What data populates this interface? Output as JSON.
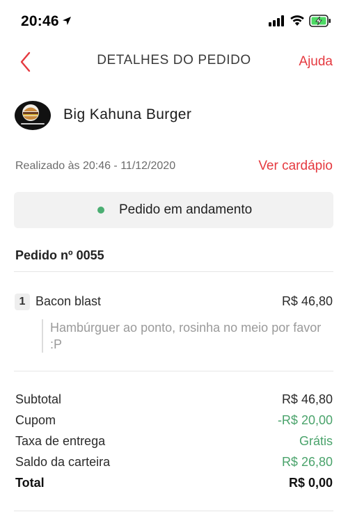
{
  "status_bar": {
    "time": "20:46"
  },
  "header": {
    "title": "DETALHES DO PEDIDO",
    "help_label": "Ajuda"
  },
  "restaurant": {
    "name": "Big Kahuna Burger"
  },
  "order": {
    "placed_at": "Realizado às 20:46 - 11/12/2020",
    "menu_link": "Ver cardápio",
    "status": "Pedido em andamento",
    "status_color": "#4bae72",
    "number": "Pedido nº 0055"
  },
  "items": [
    {
      "qty": "1",
      "name": "Bacon blast",
      "price": "R$ 46,80",
      "note": "Hambúrguer ao ponto, rosinha no meio por favor :P"
    }
  ],
  "summary": {
    "subtotal_label": "Subtotal",
    "subtotal_value": "R$ 46,80",
    "coupon_label": "Cupom",
    "coupon_value": "-R$ 20,00",
    "delivery_label": "Taxa de entrega",
    "delivery_value": "Grátis",
    "wallet_label": "Saldo da carteira",
    "wallet_value": "R$ 26,80",
    "total_label": "Total",
    "total_value": "R$ 0,00"
  },
  "colors": {
    "accent": "#e5393f",
    "positive": "#4aa36b"
  }
}
